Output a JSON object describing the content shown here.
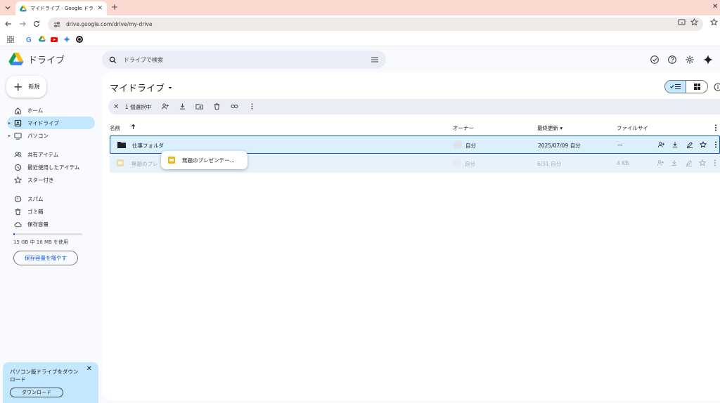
{
  "browser": {
    "tab_title": "マイドライブ - Google ドライブ",
    "url": "drive.google.com/drive/my-drive"
  },
  "app": {
    "title": "ドライブ",
    "new_label": "新規"
  },
  "search": {
    "placeholder": "ドライブで検索"
  },
  "sidebar": {
    "items": [
      {
        "label": "ホーム",
        "icon": "home-icon"
      },
      {
        "label": "マイドライブ",
        "icon": "my-drive-icon",
        "active": true
      },
      {
        "label": "パソコン",
        "icon": "computer-icon"
      },
      {
        "label": "共有アイテム",
        "icon": "shared-icon"
      },
      {
        "label": "最近使用したアイテム",
        "icon": "clock-icon"
      },
      {
        "label": "スター付き",
        "icon": "star-icon"
      },
      {
        "label": "スパム",
        "icon": "spam-icon"
      },
      {
        "label": "ゴミ箱",
        "icon": "trash-icon"
      },
      {
        "label": "保存容量",
        "icon": "cloud-icon"
      }
    ],
    "storage_text": "15 GB 中 16 MB を使用",
    "storage_button": "保存容量を増やす",
    "storage_used_fraction": 0.001
  },
  "promo": {
    "text": "パソコン版ドライブをダウンロード",
    "button": "ダウンロード"
  },
  "main": {
    "title": "マイドライブ",
    "selection_count": "1 個選択中",
    "columns": {
      "name": "名前",
      "owner": "オーナー",
      "modified": "最終更新",
      "size": "ファイルサイ"
    },
    "rows": [
      {
        "name": "仕事フォルダ",
        "owner": "自分",
        "modified": "2025/07/09 自分",
        "size": "—"
      },
      {
        "name": "無題のプレ",
        "owner": "自分",
        "modified": "6/31 自分",
        "size": "4 KB"
      }
    ],
    "drag_label": "無題のプレゼンテー..."
  },
  "colors": {
    "accent": "#0b57d0",
    "selected": "#c2e7ff",
    "surface": "#f8fafd",
    "tabbar": "#fcd9d0"
  }
}
